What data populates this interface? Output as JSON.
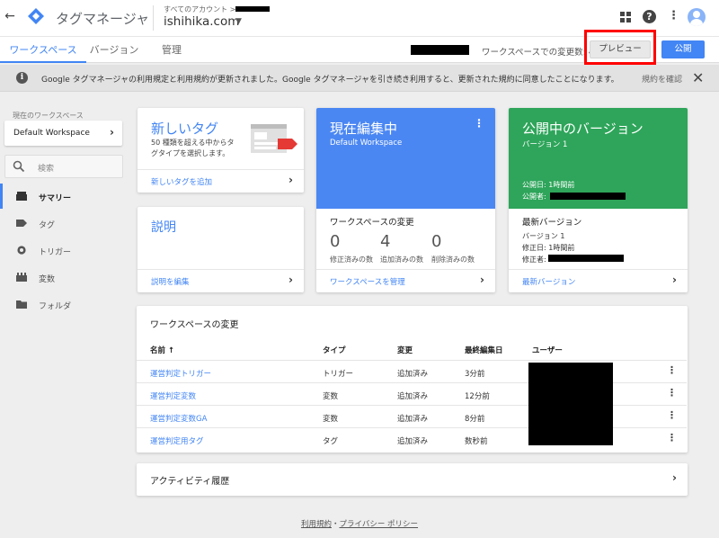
{
  "header": {
    "app_title": "タグマネージャ",
    "account_label": "すべてのアカウント >",
    "account_name": "ishihika.com",
    "icons": [
      "back-arrow-icon",
      "gtm-logo-icon",
      "apps-grid-icon",
      "help-icon",
      "more-vert-icon",
      "account-avatar-icon"
    ]
  },
  "tabs": [
    {
      "label": "ワークスペース",
      "active": true
    },
    {
      "label": "バージョン",
      "active": false
    },
    {
      "label": "管理",
      "active": false
    }
  ],
  "toolbar": {
    "changes_text": "ワークスペースでの変更数: 4",
    "preview_label": "プレビュー",
    "publish_label": "公開"
  },
  "notice": {
    "text": "Google タグマネージャの利用規定と利用規約が更新されました。Google タグマネージャを引き続き利用すると、更新された規約に同意したことになります。",
    "link": "規約を確認"
  },
  "sidebar": {
    "workspace_label": "現在のワークスペース",
    "workspace_name": "Default Workspace",
    "search_placeholder": "検索",
    "items": [
      {
        "label": "サマリー",
        "icon": "summary-icon",
        "active": true
      },
      {
        "label": "タグ",
        "icon": "tag-icon",
        "active": false
      },
      {
        "label": "トリガー",
        "icon": "trigger-icon",
        "active": false
      },
      {
        "label": "変数",
        "icon": "variable-icon",
        "active": false
      },
      {
        "label": "フォルダ",
        "icon": "folder-icon",
        "active": false
      }
    ]
  },
  "cards": {
    "new_tag": {
      "title": "新しいタグ",
      "description": "50 種類を超える中からタグタイプを選択します。",
      "link": "新しいタグを追加"
    },
    "description": {
      "title": "説明",
      "link": "説明を編集"
    },
    "editing": {
      "title": "現在編集中",
      "subtitle": "Default Workspace",
      "section_title": "ワークスペースの変更",
      "stats": [
        {
          "value": "0",
          "label": "修正済みの数"
        },
        {
          "value": "4",
          "label": "追加済みの数"
        },
        {
          "value": "0",
          "label": "削除済みの数"
        }
      ],
      "link": "ワークスペースを管理"
    },
    "published": {
      "title": "公開中のバージョン",
      "subtitle": "バージョン 1",
      "published_date": "公開日: 1時間前",
      "publisher_label": "公開者:",
      "section_title": "最新バージョン",
      "version": "バージョン 1",
      "modified_date": "修正日: 1時間前",
      "modifier_label": "修正者:",
      "link": "最新バージョン"
    }
  },
  "changes_table": {
    "title": "ワークスペースの変更",
    "columns": [
      "名前 ↑",
      "タイプ",
      "変更",
      "最終編集日",
      "ユーザー"
    ],
    "rows": [
      {
        "name": "運営判定トリガー",
        "type": "トリガー",
        "change": "追加済み",
        "edited": "3分前"
      },
      {
        "name": "運営判定変数",
        "type": "変数",
        "change": "追加済み",
        "edited": "12分前"
      },
      {
        "name": "運営判定変数GA",
        "type": "変数",
        "change": "追加済み",
        "edited": "8分前"
      },
      {
        "name": "運営判定用タグ",
        "type": "タグ",
        "change": "追加済み",
        "edited": "数秒前"
      }
    ]
  },
  "activity": {
    "label": "アクティビティ履歴"
  },
  "footer": {
    "terms": "利用規約",
    "separator": "・",
    "privacy": "プライバシー ポリシー"
  },
  "colors": {
    "accent": "#4285f4",
    "editing_card": "#4b87f3",
    "published_card": "#2ea55a",
    "highlight": "#ff0000"
  }
}
